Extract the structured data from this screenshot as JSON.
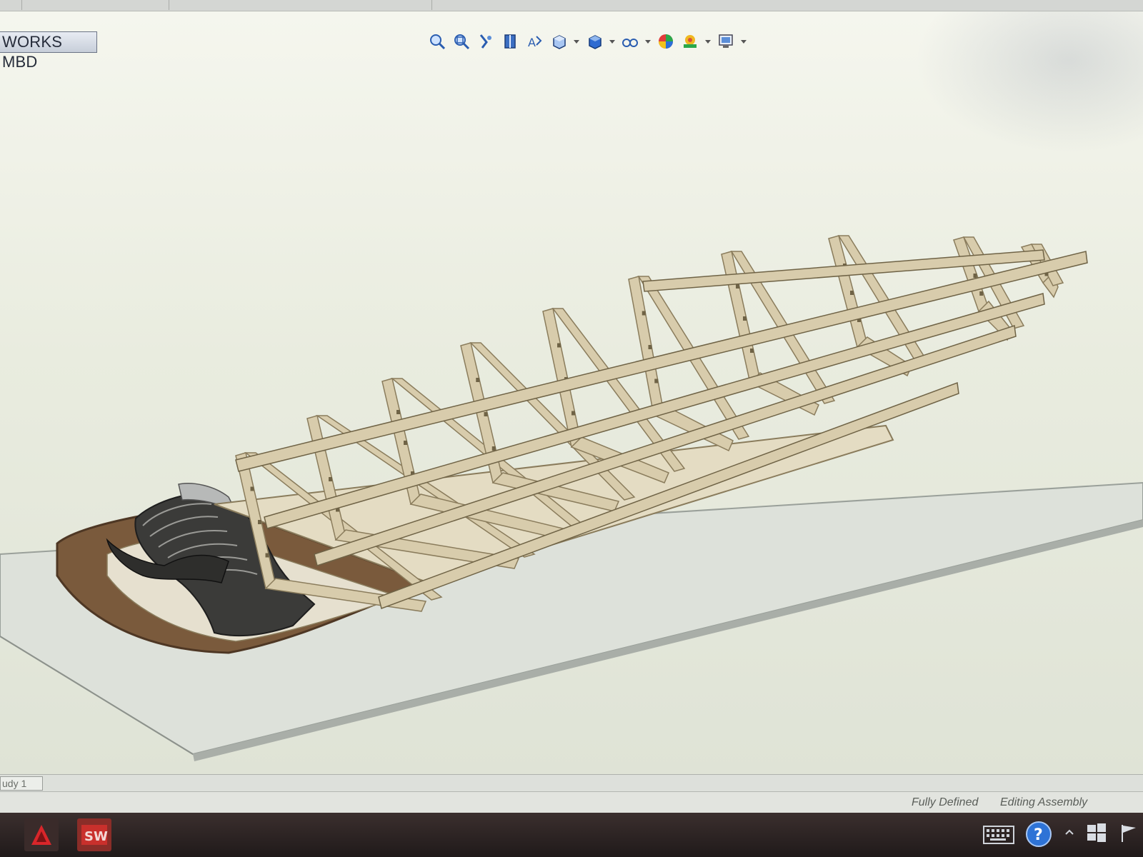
{
  "command_manager": {
    "active_tab": "WORKS MBD"
  },
  "view_toolbar": {
    "icons": [
      "zoom-to-fit-icon",
      "zoom-to-area-icon",
      "previous-view-icon",
      "section-view-icon",
      "dynamic-annotation-views-icon",
      "view-orientation-icon",
      "display-style-icon",
      "hide-show-items-icon",
      "edit-appearance-icon",
      "apply-scene-icon",
      "view-settings-icon"
    ]
  },
  "bottom_tabs": {
    "active": "udy 1"
  },
  "status_bar": {
    "state": "Fully Defined",
    "mode": "Editing Assembly"
  },
  "taskbar": {
    "apps": [
      "autocad-icon",
      "solidworks-icon"
    ],
    "tray": [
      "keyboard-icon",
      "help-icon",
      "tray-chevron-icon",
      "windows-flag-icon",
      "notification-flag-icon"
    ]
  },
  "colors": {
    "plywood": "#d8ccac",
    "plywood_edge": "#8a7c5c",
    "base_plate": "#dfe3dc",
    "walnut": "#7a5a3c"
  }
}
